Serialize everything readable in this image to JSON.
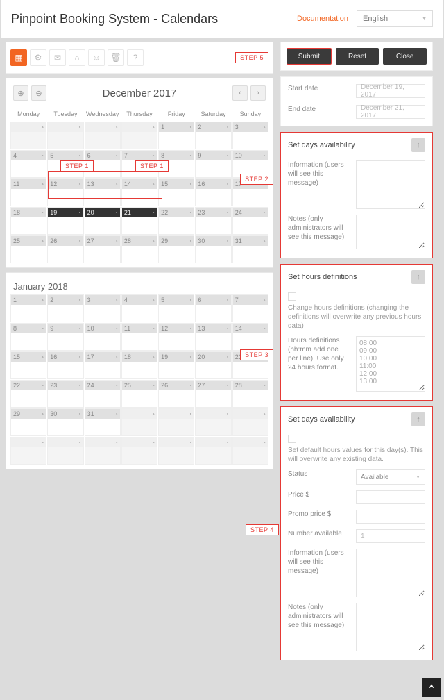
{
  "header": {
    "title": "Pinpoint Booking System - Calendars",
    "doc_link": "Documentation",
    "language": "English"
  },
  "steps": {
    "s1": "STEP 1",
    "s2": "STEP 2",
    "s3": "STEP 3",
    "s4": "STEP 4",
    "s5": "STEP 5"
  },
  "toolbar": {
    "icons": [
      "calendar-icon",
      "gear-icon",
      "mail-icon",
      "briefcase-icon",
      "users-icon",
      "trash-icon",
      "help-icon"
    ]
  },
  "calendar1": {
    "title": "December 2017",
    "weekdays": [
      "Monday",
      "Tuesday",
      "Wednesday",
      "Thursday",
      "Friday",
      "Saturday",
      "Sunday"
    ],
    "selected": [
      19,
      20,
      21
    ]
  },
  "calendar2": {
    "title": "January 2018"
  },
  "buttons": {
    "submit": "Submit",
    "reset": "Reset",
    "close": "Close"
  },
  "dates": {
    "start_label": "Start date",
    "start_value": "December 19, 2017",
    "end_label": "End date",
    "end_value": "December 21, 2017"
  },
  "avail1": {
    "title": "Set days availability",
    "info_label": "Information (users will see this message)",
    "notes_label": "Notes (only administrators will see this message)"
  },
  "hours": {
    "title": "Set hours definitions",
    "change_label": "Change hours definitions (changing the definitions will overwrite any previous hours data)",
    "def_label": "Hours definitions (hh:mm add one per line). Use only 24 hours format.",
    "def_value": "08:00\n09:00\n10:00\n11:00\n12:00\n13:00"
  },
  "avail2": {
    "title": "Set days availability",
    "default_label": "Set default hours values for this day(s). This will overwrite any existing data.",
    "status_label": "Status",
    "status_value": "Available",
    "price_label": "Price $",
    "promo_label": "Promo price $",
    "number_label": "Number available",
    "number_value": "1",
    "info_label": "Information (users will see this message)",
    "notes_label": "Notes (only administrators will see this message)"
  }
}
